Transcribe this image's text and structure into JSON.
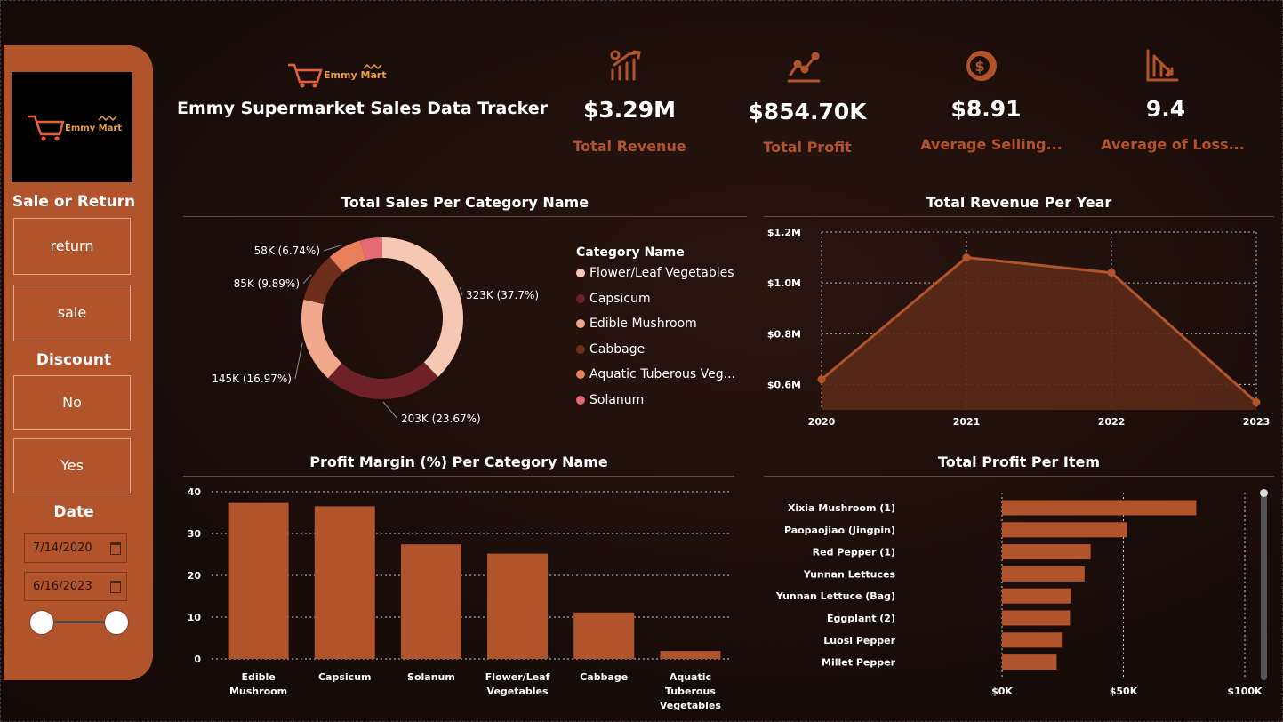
{
  "header": {
    "title": "Emmy Supermarket Sales Data Tracker",
    "brand": "Emmy Mart"
  },
  "kpis": [
    {
      "value": "$3.29M",
      "label": "Total Revenue",
      "icon": "revenue-growth-icon"
    },
    {
      "value": "$854.70K",
      "label": "Total Profit",
      "icon": "trend-line-icon"
    },
    {
      "value": "$8.91",
      "label": "Average Selling...",
      "icon": "dollar-coin-icon"
    },
    {
      "value": "9.4",
      "label": "Average of Loss...",
      "icon": "loss-decline-icon"
    }
  ],
  "sidebar": {
    "sale_or_return_title": "Sale or Return",
    "sale_or_return_options": [
      "return",
      "sale"
    ],
    "discount_title": "Discount",
    "discount_options": [
      "No",
      "Yes"
    ],
    "date_title": "Date",
    "date_start": "7/14/2020",
    "date_end": "6/16/2023"
  },
  "colors": {
    "accent": "#b1532b",
    "series": [
      "#f6c8b4",
      "#6e2228",
      "#f1a88c",
      "#6d2f1b",
      "#e8805a",
      "#e46a74"
    ]
  },
  "chart_data": [
    {
      "type": "pie",
      "title": "Total Sales Per Category Name",
      "legend_title": "Category Name",
      "legend_position": "right",
      "categories": [
        "Flower/Leaf Vegetables",
        "Capsicum",
        "Edible Mushroom",
        "Cabbage",
        "Aquatic Tuberous Veg...",
        "Solanum"
      ],
      "values": [
        323,
        203,
        145,
        85,
        58,
        38
      ],
      "data_labels": [
        "323K (37.7%)",
        "203K (23.67%)",
        "145K (16.97%)",
        "85K (9.89%)",
        "58K (6.74%)",
        ""
      ]
    },
    {
      "type": "area",
      "title": "Total Revenue Per Year",
      "x": [
        "2020",
        "2021",
        "2022",
        "2023"
      ],
      "values": [
        0.62,
        1.1,
        1.04,
        0.53
      ],
      "ylim": [
        0.5,
        1.2
      ],
      "yticks": [
        "$0.6M",
        "$0.8M",
        "$1.0M",
        "$1.2M"
      ],
      "ytick_values": [
        0.6,
        0.8,
        1.0,
        1.2
      ],
      "grid": true
    },
    {
      "type": "bar",
      "title": "Profit Margin (%) Per Category Name",
      "categories": [
        [
          "Edible",
          "Mushroom"
        ],
        [
          "Capsicum"
        ],
        [
          "Solanum"
        ],
        [
          "Flower/Leaf",
          "Vegetables"
        ],
        [
          "Cabbage"
        ],
        [
          "Aquatic",
          "Tuberous",
          "Vegetables"
        ]
      ],
      "values": [
        37.3,
        36.5,
        27.4,
        25.2,
        11.1,
        1.9
      ],
      "ylim": [
        0,
        40
      ],
      "yticks": [
        "0",
        "10",
        "20",
        "30",
        "40"
      ],
      "ytick_values": [
        0,
        10,
        20,
        30,
        40
      ],
      "grid": true
    },
    {
      "type": "bar",
      "orientation": "horizontal",
      "title": "Total Profit Per Item",
      "categories": [
        "Xixia Mushroom (1)",
        "Paopaojiao (Jingpin)",
        "Red Pepper (1)",
        "Yunnan Lettuces",
        "Yunnan Lettuce (Bag)",
        "Eggplant (2)",
        "Luosi Pepper",
        "Millet Pepper"
      ],
      "values": [
        80,
        51.5,
        36.5,
        34,
        28.5,
        28,
        25,
        22.5
      ],
      "xlim": [
        0,
        100
      ],
      "xticks": [
        "$0K",
        "$50K",
        "$100K"
      ],
      "xtick_values": [
        0,
        50,
        100
      ],
      "grid": true
    }
  ]
}
